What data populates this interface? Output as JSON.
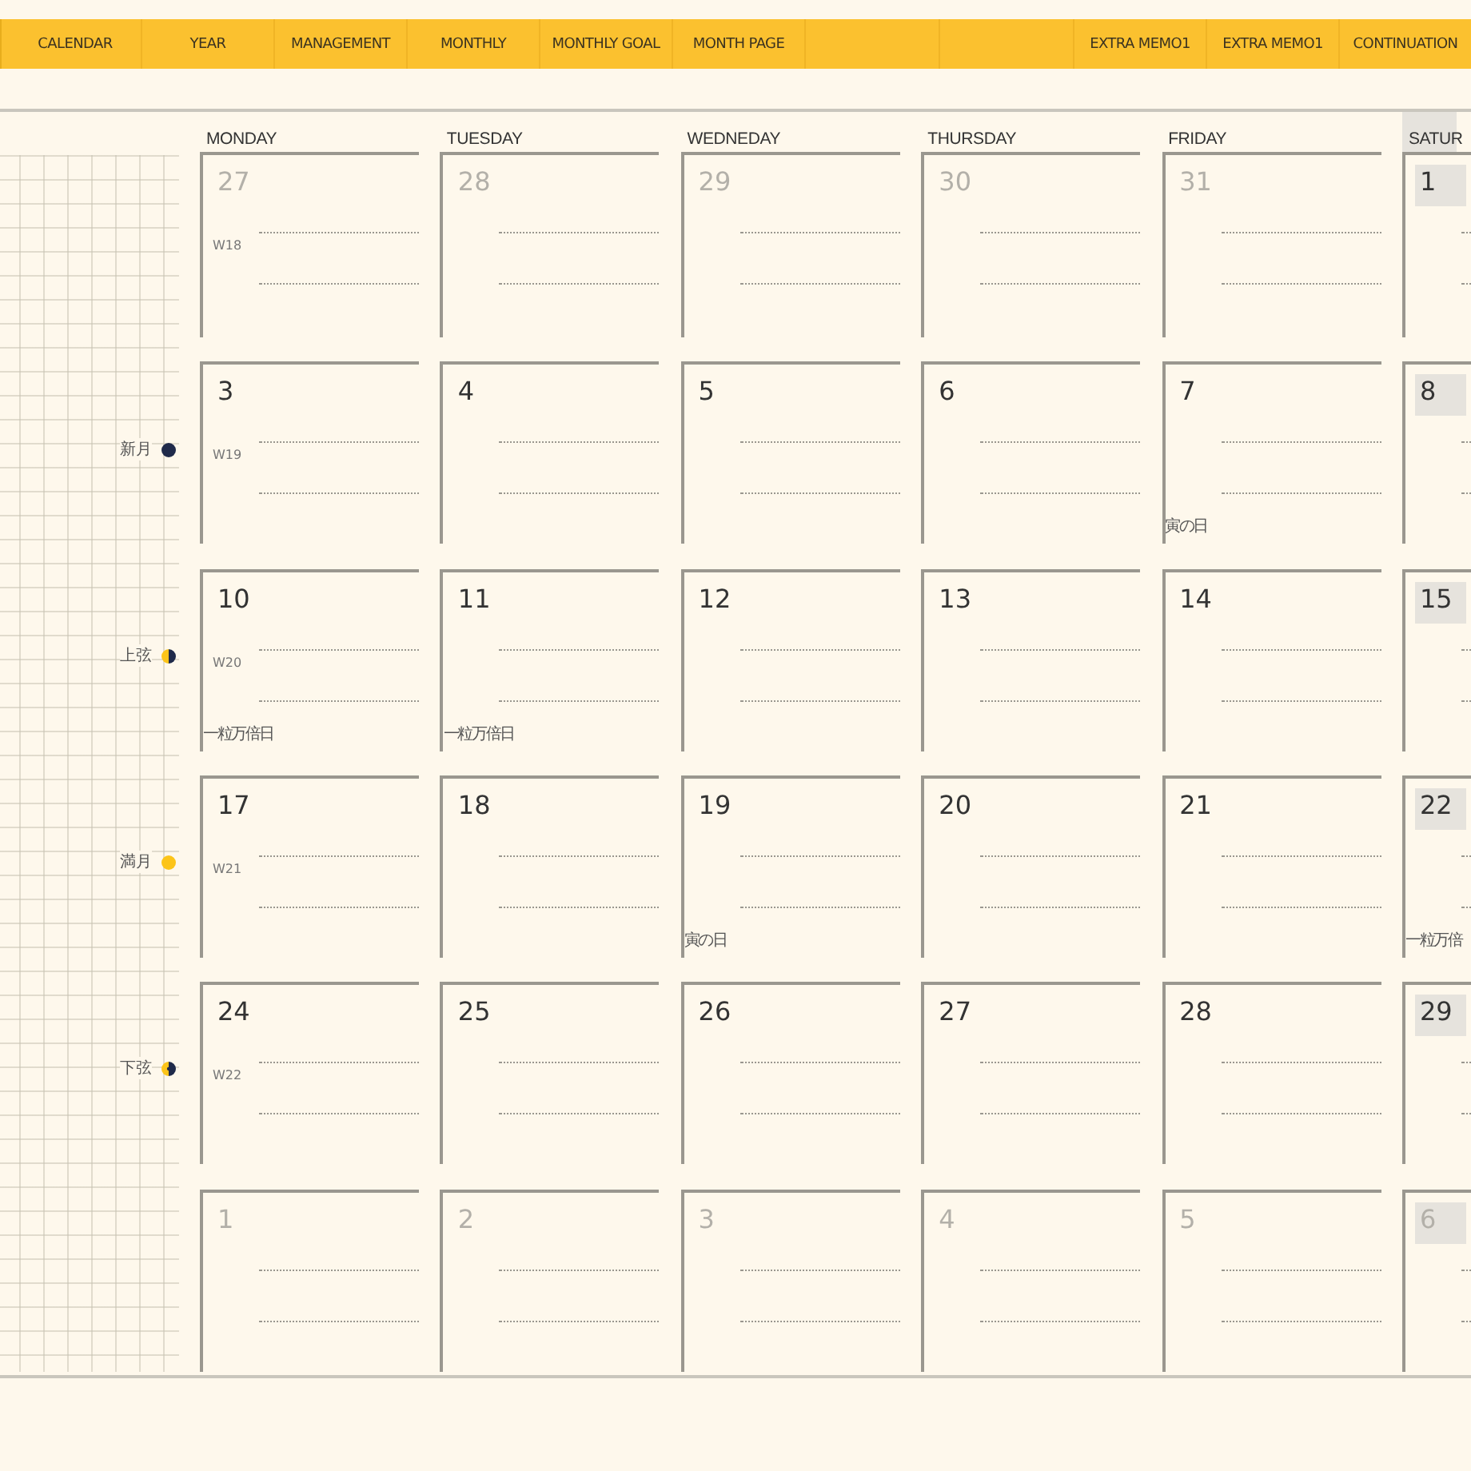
{
  "tabs": [
    {
      "kind": "tab",
      "label": "CALENDAR"
    },
    {
      "kind": "tab",
      "label": "YEAR"
    },
    {
      "kind": "tab",
      "label": "MANAGEMENT"
    },
    {
      "kind": "tab",
      "label": "MONTHLY"
    },
    {
      "kind": "tab",
      "label": "MONTHLY GOAL"
    },
    {
      "kind": "tab",
      "label": "MONTH PAGE"
    },
    {
      "kind": "blank"
    },
    {
      "kind": "blank"
    },
    {
      "kind": "tab",
      "label": "EXTRA MEMO1"
    },
    {
      "kind": "tab",
      "label": "EXTRA MEMO1"
    },
    {
      "kind": "tab",
      "label": "CONTINUATION"
    }
  ],
  "day_headers": [
    {
      "label": "MONDAY",
      "highlighted": false
    },
    {
      "label": "TUESDAY",
      "highlighted": false
    },
    {
      "label": "WEDNEDAY",
      "highlighted": false
    },
    {
      "label": "THURSDAY",
      "highlighted": false
    },
    {
      "label": "FRIDAY",
      "highlighted": false
    },
    {
      "label": "SATUR",
      "highlighted": true
    }
  ],
  "weeks": [
    {
      "week": "W18",
      "days": [
        {
          "date": "27",
          "muted": true
        },
        {
          "date": "28",
          "muted": true
        },
        {
          "date": "29",
          "muted": true
        },
        {
          "date": "30",
          "muted": true
        },
        {
          "date": "31",
          "muted": true
        },
        {
          "date": "1",
          "muted": false
        }
      ]
    },
    {
      "week": "W19",
      "moon": {
        "label": "新月",
        "kind": "new"
      },
      "days": [
        {
          "date": "3",
          "muted": false
        },
        {
          "date": "4",
          "muted": false
        },
        {
          "date": "5",
          "muted": false
        },
        {
          "date": "6",
          "muted": false
        },
        {
          "date": "7",
          "muted": false,
          "note": "寅の日"
        },
        {
          "date": "8",
          "muted": false
        }
      ]
    },
    {
      "week": "W20",
      "moon": {
        "label": "上弦",
        "kind": "first_quarter"
      },
      "days": [
        {
          "date": "10",
          "muted": false,
          "note": "一粒万倍日"
        },
        {
          "date": "11",
          "muted": false,
          "note": "一粒万倍日"
        },
        {
          "date": "12",
          "muted": false
        },
        {
          "date": "13",
          "muted": false
        },
        {
          "date": "14",
          "muted": false
        },
        {
          "date": "15",
          "muted": false
        }
      ]
    },
    {
      "week": "W21",
      "moon": {
        "label": "満月",
        "kind": "full"
      },
      "days": [
        {
          "date": "17",
          "muted": false
        },
        {
          "date": "18",
          "muted": false
        },
        {
          "date": "19",
          "muted": false,
          "note": "寅の日"
        },
        {
          "date": "20",
          "muted": false
        },
        {
          "date": "21",
          "muted": false
        },
        {
          "date": "22",
          "muted": false,
          "note": "一粒万倍"
        }
      ]
    },
    {
      "week": "W22",
      "moon": {
        "label": "下弦",
        "kind": "last_quarter"
      },
      "days": [
        {
          "date": "24",
          "muted": false
        },
        {
          "date": "25",
          "muted": false
        },
        {
          "date": "26",
          "muted": false
        },
        {
          "date": "27",
          "muted": false
        },
        {
          "date": "28",
          "muted": false
        },
        {
          "date": "29",
          "muted": false
        }
      ]
    },
    {
      "days": [
        {
          "date": "1",
          "muted": true
        },
        {
          "date": "2",
          "muted": true
        },
        {
          "date": "3",
          "muted": true
        },
        {
          "date": "4",
          "muted": true
        },
        {
          "date": "5",
          "muted": true
        },
        {
          "date": "6",
          "muted": true
        }
      ]
    }
  ]
}
